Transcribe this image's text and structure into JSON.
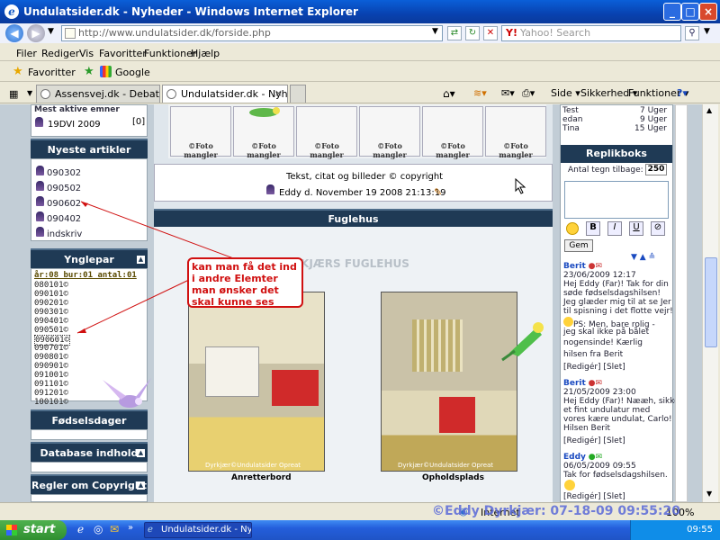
{
  "window": {
    "title": "Undulatsider.dk - Nyheder - Windows Internet Explorer"
  },
  "toolbar": {
    "url": "http://www.undulatsider.dk/forside.php",
    "search_placeholder": "Yahoo! Search"
  },
  "menu": [
    "Filer",
    "Rediger",
    "Vis",
    "Favoritter",
    "Funktioner",
    "Hjælp"
  ],
  "favbar": {
    "favorites": "Favoritter",
    "google": "Google"
  },
  "tabs": [
    {
      "label": "Assensvej.dk - Debatforum: ..."
    },
    {
      "label": "Undulatsider.dk - Nyheder"
    }
  ],
  "commandbar": {
    "side": "Side",
    "security": "Sikkerhed",
    "tools": "Funktioner"
  },
  "left": {
    "most_active_label": "Mest aktive emner",
    "most_active_item": "19DVI 2009",
    "most_active_count": "[0]",
    "articles_title": "Nyeste artikler",
    "articles": [
      "090302",
      "090502",
      "090602",
      "090402",
      "indskriv"
    ],
    "ynglepar_title": "Ynglepar",
    "ynglepar_header": "år:08 bur:01 antal:01",
    "ynglepar_items": [
      "080101©",
      "090101©",
      "090201©",
      "090301©",
      "090401©",
      "090501©",
      "090601©",
      "090701©",
      "090801©",
      "090901©",
      "091001©",
      "091101©",
      "091201©",
      "100101©"
    ],
    "birthdays_title": "Fødselsdager",
    "database_title": "Database indhold",
    "rules_title": "Regler om Copyright"
  },
  "main": {
    "foto_label": "©Foto mangler",
    "copyright_text": "Tekst, citat og billeder © copyright",
    "byline": "Eddy d. November 19 2008 21:13:19",
    "section_title": "Fuglehus",
    "watermark_text": "DYRKJÆRS FUGLEHUS",
    "photo1_credit": "Dyrkjær©Undulatsider Opreat",
    "photo1_caption": "Anretterbord",
    "photo2_credit": "Dyrkjær©Undulatsider Opreat",
    "photo2_caption": "Opholdsplads"
  },
  "right": {
    "top_rows": [
      {
        "name": "Test",
        "value": "7 Uger"
      },
      {
        "name": "edan",
        "value": "9 Uger"
      },
      {
        "name": "Tina",
        "value": "15 Uger"
      }
    ],
    "shoutbox_title": "Replikboks",
    "chars_label": "Antal tegn tilbage:",
    "chars_value": "250",
    "send_button": "Gem",
    "messages": [
      {
        "author": "Berit",
        "date": "23/06/2009 12:17",
        "lines": [
          "Hej Eddy (Far)! Tak for din",
          "søde fødselsdagshilsen!",
          "Jeg glæder mig til at se Jer",
          "til spisning i det flotte vejr!",
          "PS: Men, bare rolig -",
          "jeg skal ikke på bålet",
          "nogensinde! Kærlig",
          "hilsen fra Berit"
        ]
      },
      {
        "author": "Berit",
        "date": "21/05/2009 23:00",
        "lines": [
          "Hej Eddy (Far)! Nææh, sikke",
          "et fint undulatur med",
          "vores kære undulat, Carlo!",
          "Hilsen Berit"
        ]
      },
      {
        "author": "Eddy",
        "date": "06/05/2009 09:55",
        "lines": [
          "Tak for fødselsdagshilsen."
        ]
      }
    ],
    "edit_label": "[Redigér] [Slet]"
  },
  "callout": {
    "text": "kan man få det ind i andre Elemter man ønsker det skal kunne ses"
  },
  "watermark": "©Eddy Dyrkjær: 07-18-09 09:55:20",
  "status": {
    "zone": "Internet",
    "zoom": "100%"
  },
  "taskbar": {
    "start": "start",
    "task": "Undulatsider.dk - Nyh...",
    "clock": "09:55"
  }
}
